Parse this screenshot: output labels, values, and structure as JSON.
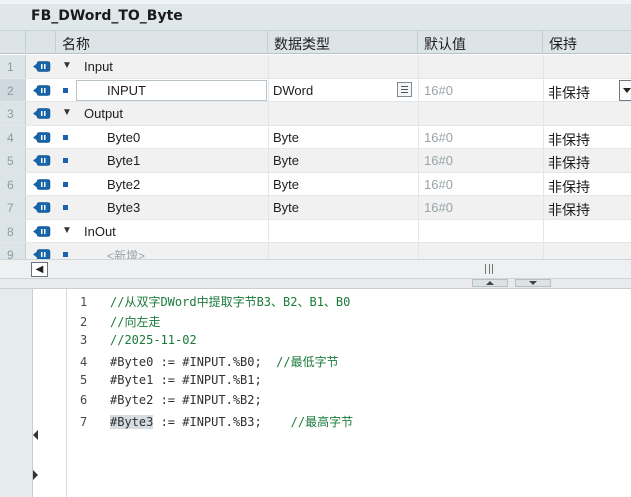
{
  "block_title": "FB_DWord_TO_Byte",
  "columns": {
    "name": "名称",
    "datatype": "数据类型",
    "default": "默认值",
    "retain": "保持"
  },
  "rows": [
    {
      "num": "1",
      "kind": "section",
      "name": "Input",
      "datatype": "",
      "default": "",
      "retain": ""
    },
    {
      "num": "2",
      "kind": "item",
      "name": "INPUT",
      "datatype": "DWord",
      "default": "16#0",
      "retain": "非保持",
      "selected": true
    },
    {
      "num": "3",
      "kind": "section",
      "name": "Output",
      "datatype": "",
      "default": "",
      "retain": ""
    },
    {
      "num": "4",
      "kind": "item",
      "name": "Byte0",
      "datatype": "Byte",
      "default": "16#0",
      "retain": "非保持"
    },
    {
      "num": "5",
      "kind": "item",
      "name": "Byte1",
      "datatype": "Byte",
      "default": "16#0",
      "retain": "非保持"
    },
    {
      "num": "6",
      "kind": "item",
      "name": "Byte2",
      "datatype": "Byte",
      "default": "16#0",
      "retain": "非保持"
    },
    {
      "num": "7",
      "kind": "item",
      "name": "Byte3",
      "datatype": "Byte",
      "default": "16#0",
      "retain": "非保持"
    },
    {
      "num": "8",
      "kind": "section",
      "name": "InOut",
      "datatype": "",
      "default": "",
      "retain": ""
    },
    {
      "num": "9",
      "kind": "new",
      "name": "<新增>",
      "datatype": "",
      "default": "",
      "retain": ""
    }
  ],
  "code": [
    {
      "num": "1",
      "text": "",
      "comment": "//从双字DWord中提取字节B3、B2、B1、B0"
    },
    {
      "num": "2",
      "text": "",
      "comment": "//向左走"
    },
    {
      "num": "3",
      "text": "",
      "comment": "//2025-11-02"
    },
    {
      "num": "4",
      "text": "#Byte0 := #INPUT.%B0;  ",
      "comment": "//最低字节"
    },
    {
      "num": "5",
      "text": "#Byte1 := #INPUT.%B1;",
      "comment": ""
    },
    {
      "num": "6",
      "text": "#Byte2 := #INPUT.%B2;",
      "comment": ""
    },
    {
      "num": "7",
      "text": "#Byte3",
      "text2": " := #INPUT.%B3;    ",
      "comment": "//最高字节"
    }
  ],
  "icon_colors": {
    "interface_icon_bg": "#1565a8",
    "interface_icon_fg": "#ffffff",
    "accent": "#1f5fb0",
    "comment": "#1b7a3a"
  }
}
